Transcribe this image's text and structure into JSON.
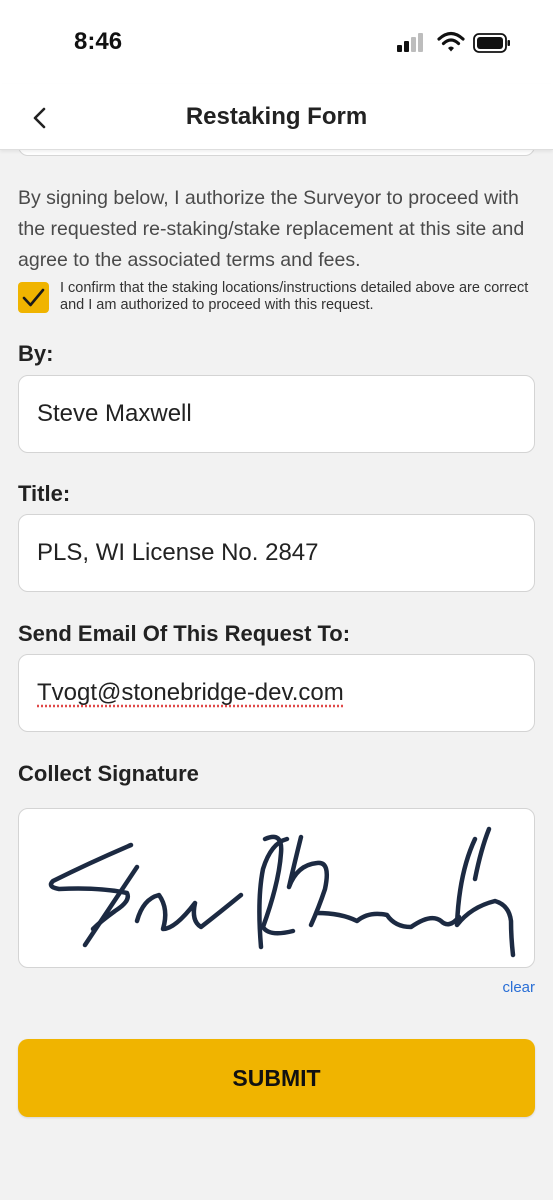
{
  "status_bar": {
    "time": "8:46"
  },
  "nav": {
    "title": "Restaking Form"
  },
  "form": {
    "authorization_text": "By signing below, I authorize the Surveyor to proceed with the requested re-staking/stake replacement at this site and agree to the associated terms and fees.",
    "confirm_checked": true,
    "confirm_text": "I confirm that the staking locations/instructions detailed above are correct and I am authorized to proceed with this request.",
    "by": {
      "label": "By:",
      "value": "Steve Maxwell"
    },
    "title": {
      "label": "Title:",
      "value": "PLS, WI License No. 2847"
    },
    "email": {
      "label": "Send Email Of This Request To:",
      "value": "Tvogt@stonebridge-dev.com"
    },
    "signature": {
      "label": "Collect Signature",
      "clear_label": "clear"
    },
    "submit_label": "SUBMIT"
  },
  "colors": {
    "accent": "#f0b400",
    "link": "#2a6fd6",
    "background": "#f2f2f2"
  }
}
